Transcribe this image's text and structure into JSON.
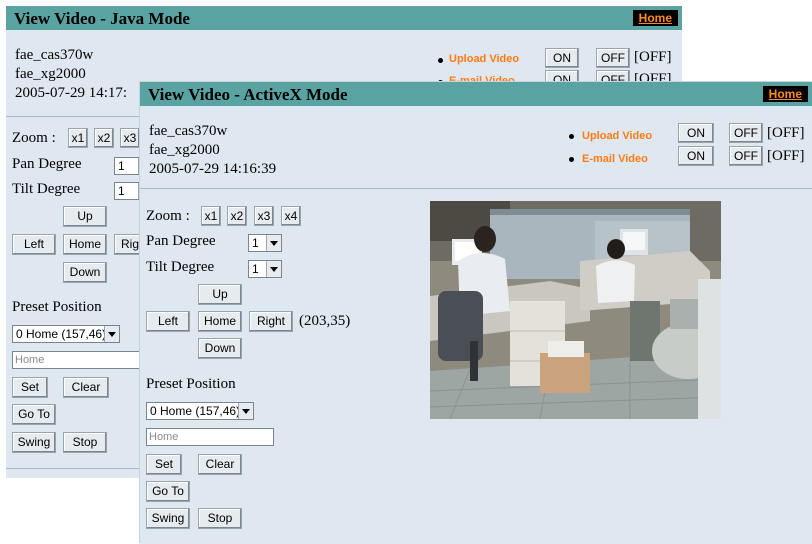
{
  "java": {
    "title": "View Video - Java Mode",
    "home": "Home",
    "info": [
      "fae_cas370w",
      "fae_xg2000",
      "2005-07-29 14:17:"
    ],
    "upload_label": "Upload Video",
    "email_label": "E-mail Video",
    "on": "ON",
    "off": "OFF",
    "state1": "[OFF]",
    "state2": "[OFF]",
    "zoom_label": "Zoom :",
    "zoom": [
      "x1",
      "x2",
      "x3"
    ],
    "pan_label": "Pan Degree",
    "pan_value": "1",
    "tilt_label": "Tilt Degree",
    "tilt_value": "1",
    "up": "Up",
    "left": "Left",
    "homebtn": "Home",
    "right": "Rig",
    "down": "Down",
    "preset_label": "Preset Position",
    "preset_value": "0 Home (157,46)",
    "preset_name": "Home",
    "set": "Set",
    "clear": "Clear",
    "goto": "Go To",
    "swing": "Swing",
    "stop": "Stop"
  },
  "activex": {
    "title": "View Video - ActiveX Mode",
    "home": "Home",
    "info": [
      "fae_cas370w",
      "fae_xg2000",
      "2005-07-29 14:16:39"
    ],
    "upload_label": "Upload Video",
    "email_label": "E-mail Video",
    "on": "ON",
    "off": "OFF",
    "state1": "[OFF]",
    "state2": "[OFF]",
    "zoom_label": "Zoom :",
    "zoom": [
      "x1",
      "x2",
      "x3",
      "x4"
    ],
    "pan_label": "Pan Degree",
    "pan_value": "1",
    "tilt_label": "Tilt Degree",
    "tilt_value": "1",
    "up": "Up",
    "left": "Left",
    "homebtn": "Home",
    "right": "Right",
    "down": "Down",
    "coords": "(203,35)",
    "preset_label": "Preset Position",
    "preset_value": "0 Home (157,46)",
    "preset_name": "Home",
    "set": "Set",
    "clear": "Clear",
    "goto": "Go To",
    "swing": "Swing",
    "stop": "Stop"
  },
  "colors": {
    "titlebar": "#5aa3a3",
    "panel": "#dfe8f0",
    "link": "#ff7a12"
  }
}
